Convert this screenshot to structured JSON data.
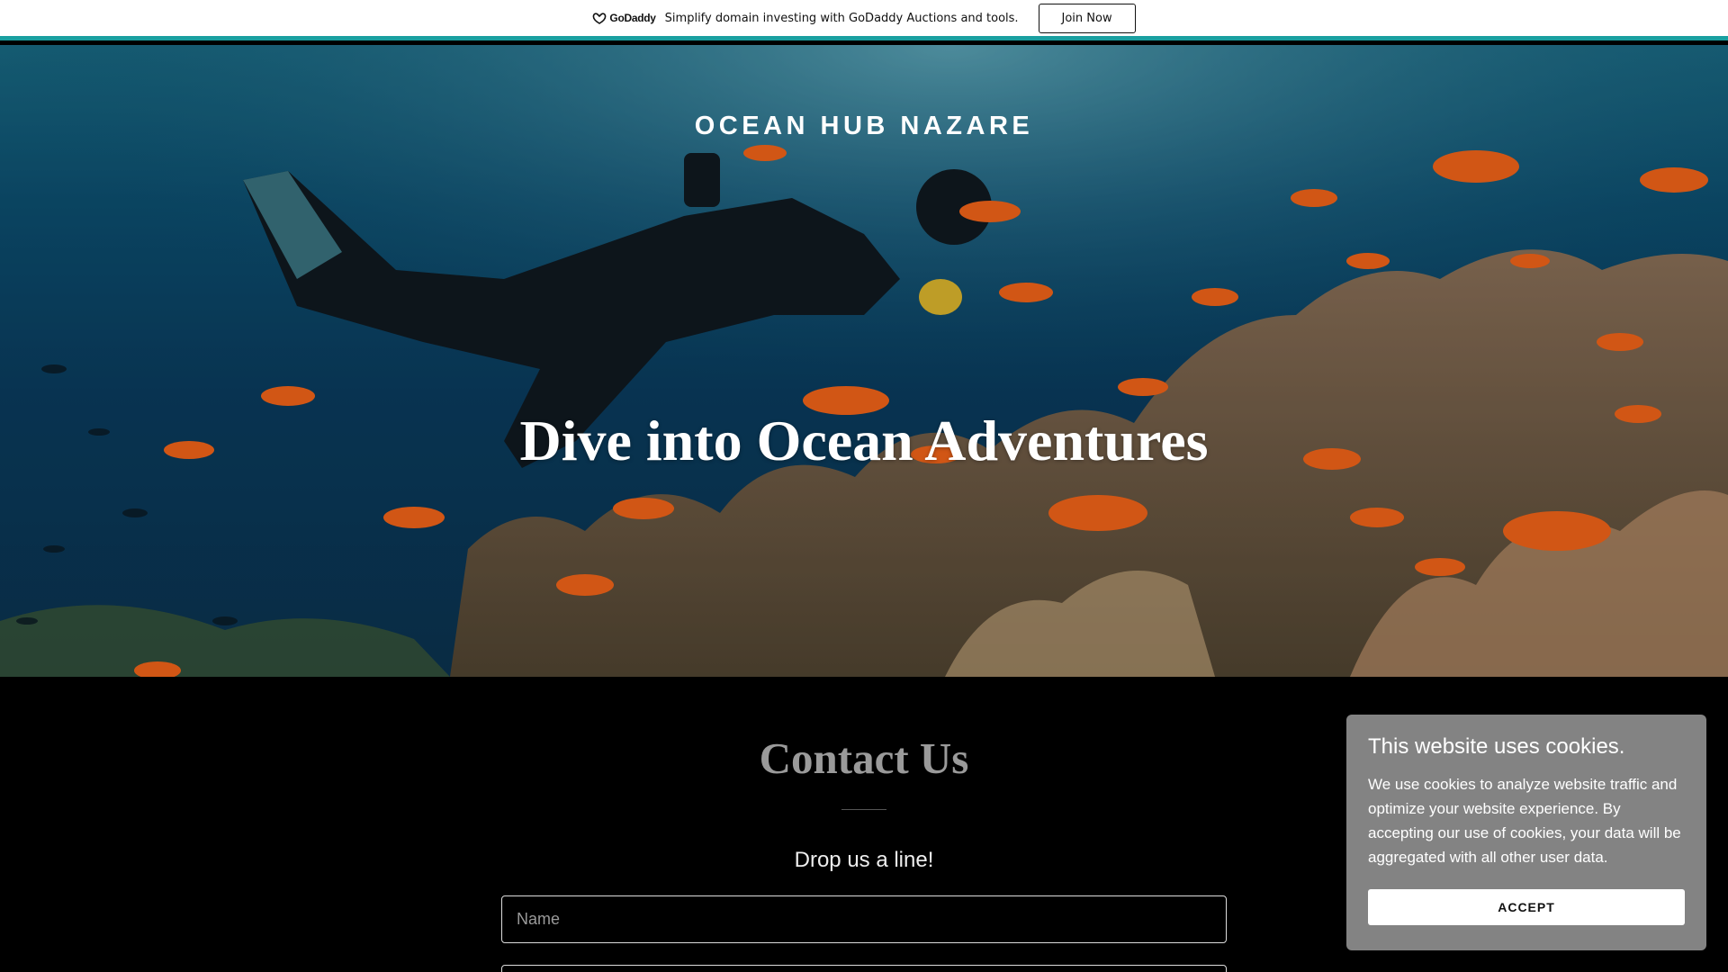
{
  "promo": {
    "logo_text": "GoDaddy",
    "message": "Simplify domain investing with GoDaddy Auctions and tools.",
    "button_label": "Join Now"
  },
  "hero": {
    "site_title": "OCEAN HUB NAZARE",
    "heading": "Dive into Ocean Adventures"
  },
  "contact": {
    "title": "Contact Us",
    "subtitle": "Drop us a line!",
    "name_placeholder": "Name",
    "email_placeholder": ""
  },
  "cookie": {
    "title": "This website uses cookies.",
    "text": "We use cookies to analyze website traffic and optimize your website experience. By accepting our use of cookies, your data will be aggregated with all other user data.",
    "accept_label": "ACCEPT"
  },
  "colors": {
    "promo_accent": "#1a9fa0",
    "cookie_bg": "#838383",
    "contact_bg": "#000000"
  }
}
